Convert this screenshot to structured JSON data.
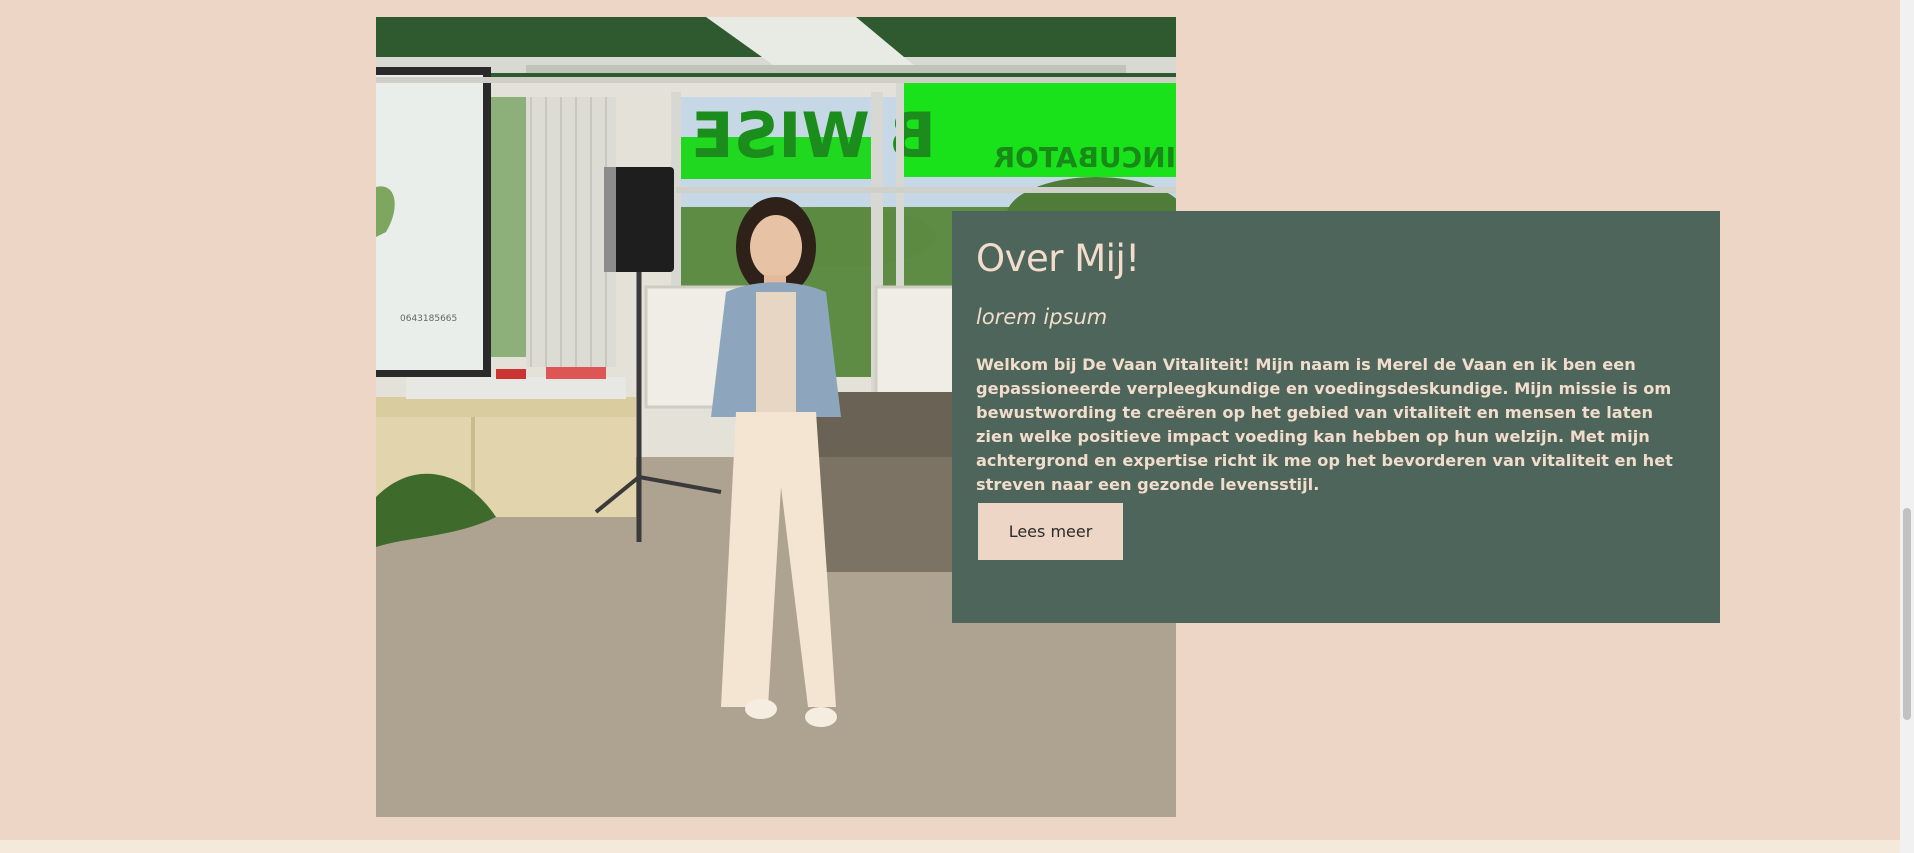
{
  "about": {
    "title": "Over Mij!",
    "subtitle": "lorem ipsum",
    "text": "Welkom bij De Vaan Vitaliteit! Mijn naam is Merel de Vaan en ik ben een gepassioneerde verpleegkundige en voedingsdeskundige. Mijn missie is om bewustwording te creëren op het gebied van vitaliteit en mensen te laten zien welke positieve impact voeding kan hebben op hun welzijn. Met mijn achtergrond en expertise richt ik me op het bevorderen van vitaliteit en het streven naar een gezonde levensstijl.",
    "button_label": "Lees meer"
  },
  "photo": {
    "window_sign_main": "B'WISE",
    "window_sign_sub": "INCUBATOR",
    "screen_phone": "0643185665"
  },
  "colors": {
    "page_background": "#EDD6C5",
    "card_background": "#4D655A",
    "card_text": "#F2DCCB",
    "button_background": "#EDD6C5"
  }
}
